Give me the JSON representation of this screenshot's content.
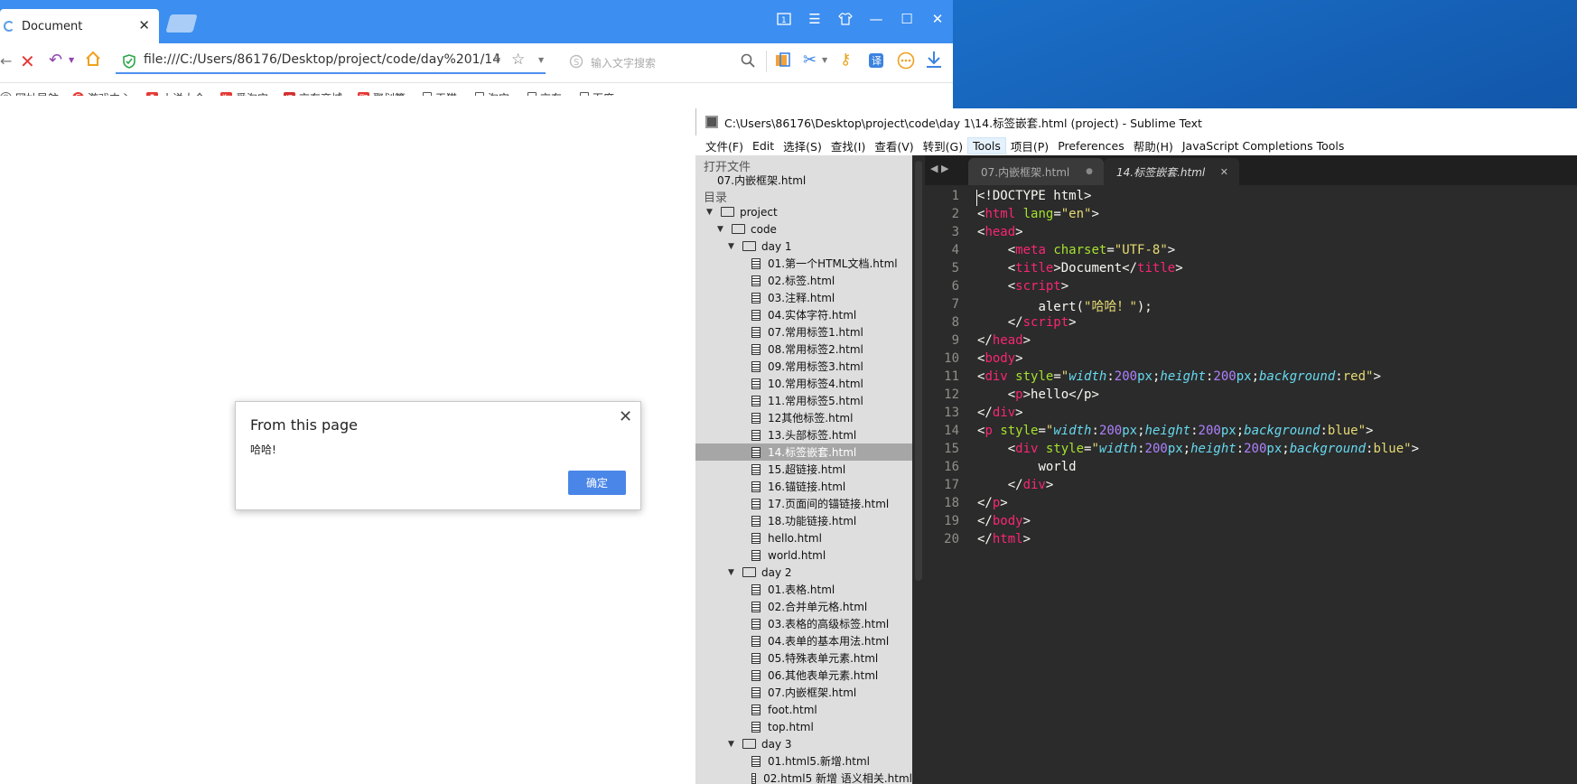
{
  "browser": {
    "tab_title": "Document",
    "url": "file:///C:/Users/86176/Desktop/project/code/day%201/14",
    "search_placeholder": "输入文字搜索",
    "bookmarks": [
      "网址导航",
      "游戏中心",
      "小说大全",
      "爱淘宝",
      "京东商城",
      "聚划算",
      "天猫",
      "淘宝",
      "京东",
      "百度"
    ]
  },
  "dialog": {
    "title": "From this page",
    "message": "哈哈!",
    "ok_label": "确定"
  },
  "sublime": {
    "title": "C:\\Users\\86176\\Desktop\\project\\code\\day 1\\14.标签嵌套.html (project) - Sublime Text",
    "menu": [
      "文件(F)",
      "Edit",
      "选择(S)",
      "查找(I)",
      "查看(V)",
      "转到(G)",
      "Tools",
      "项目(P)",
      "Preferences",
      "帮助(H)",
      "JavaScript Completions Tools"
    ],
    "active_menu": "Tools",
    "sidebar": {
      "open_files_header": "打开文件",
      "open_file": "07.内嵌框架.html",
      "folders_header": "目录",
      "tree": {
        "project": "project",
        "code": "code",
        "day1": "day 1",
        "day1_files": [
          "01.第一个HTML文档.html",
          "02.标签.html",
          "03.注释.html",
          "04.实体字符.html",
          "07.常用标签1.html",
          "08.常用标签2.html",
          "09.常用标签3.html",
          "10.常用标签4.html",
          "11.常用标签5.html",
          "12其他标签.html",
          "13.头部标签.html",
          "14.标签嵌套.html",
          "15.超链接.html",
          "16.锚链接.html",
          "17.页面间的锚链接.html",
          "18.功能链接.html",
          "hello.html",
          "world.html"
        ],
        "day2": "day 2",
        "day2_files": [
          "01.表格.html",
          "02.合并单元格.html",
          "03.表格的高级标签.html",
          "04.表单的基本用法.html",
          "05.特殊表单元素.html",
          "06.其他表单元素.html",
          "07.内嵌框架.html",
          "foot.html",
          "top.html"
        ],
        "day3": "day 3",
        "day3_files": [
          "01.html5.新增.html",
          "02.html5 新增 语义相关.html"
        ]
      },
      "selected_file": "14.标签嵌套.html"
    },
    "tabs": [
      "07.内嵌框架.html",
      "14.标签嵌套.html"
    ],
    "line_numbers": [
      "1",
      "2",
      "3",
      "4",
      "5",
      "6",
      "7",
      "8",
      "9",
      "10",
      "11",
      "12",
      "13",
      "14",
      "15",
      "16",
      "17",
      "18",
      "19",
      "20"
    ],
    "code": {
      "doctype": "<!DOCTYPE html>",
      "lang_attr": "lang",
      "lang_val": "\"en\"",
      "charset_val": "\"UTF-8\"",
      "title_text": "Document",
      "alert_fn": "alert(",
      "alert_str": "\"哈哈！\"",
      "alert_end": ");",
      "hello": "hello",
      "world": "world",
      "bg_red": "red",
      "bg_blue": "blue",
      "px200": "200"
    }
  }
}
